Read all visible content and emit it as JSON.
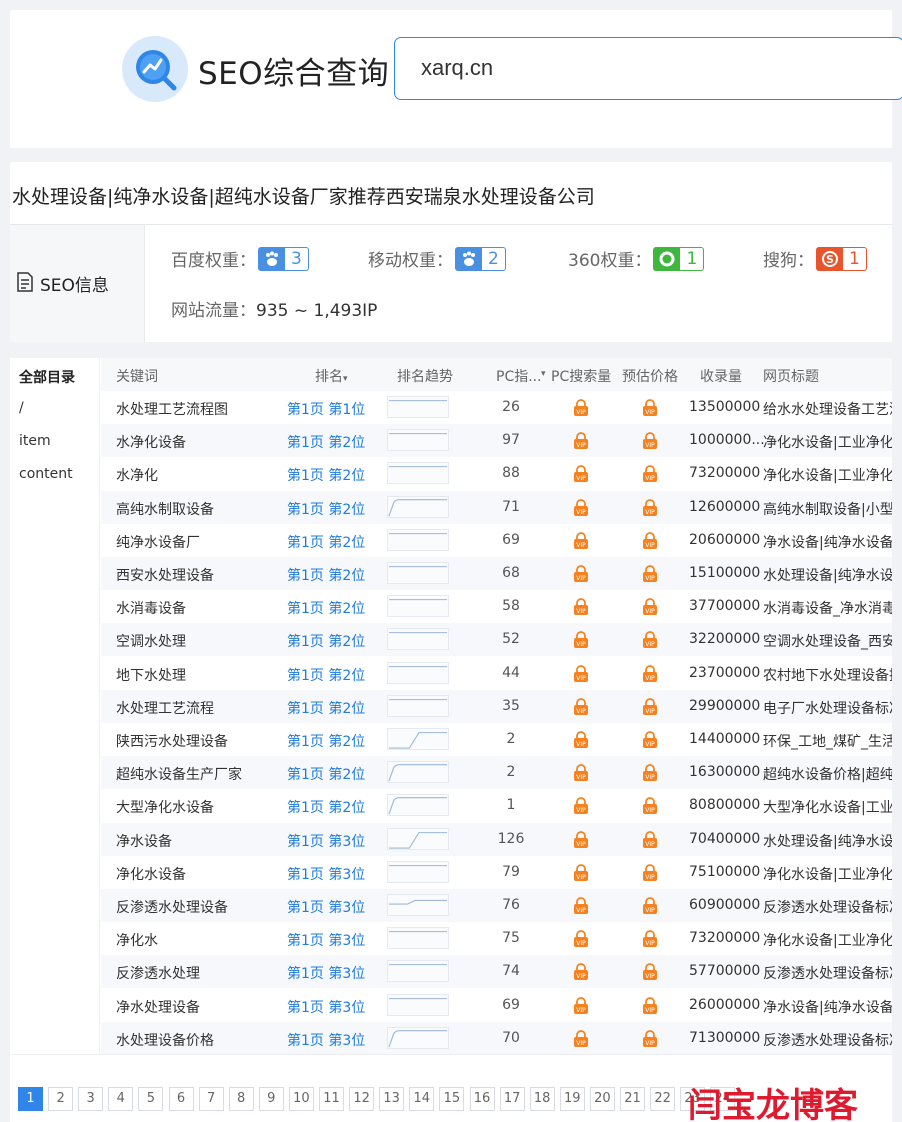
{
  "header": {
    "brand": "SEO综合查询",
    "search_value": "xarq.cn"
  },
  "site": {
    "title": "水处理设备|纯净水设备|超纯水设备厂家推荐西安瑞泉水处理设备公司",
    "section_label": "SEO信息",
    "weights": [
      {
        "label": "百度权重：",
        "value": "3",
        "icon": "baidu-paw-icon",
        "color": "#4a90e2"
      },
      {
        "label": "移动权重：",
        "value": "2",
        "icon": "baidu-paw-icon",
        "color": "#4a90e2"
      },
      {
        "label": "360权重：",
        "value": "1",
        "icon": "360-icon",
        "color": "#3fb73f"
      },
      {
        "label": "搜狗：",
        "value": "1",
        "icon": "sogou-icon",
        "color": "#e8542b"
      }
    ],
    "traffic_label": "网站流量：",
    "traffic_value": "935 ~ 1,493IP"
  },
  "sidebar": {
    "header": "全部目录",
    "items": [
      "/",
      "item",
      "content"
    ]
  },
  "table": {
    "columns": [
      "关键词",
      "排名",
      "排名趋势",
      "PC指...",
      "PC搜索量",
      "预估价格",
      "收录量",
      "网页标题"
    ],
    "rows": [
      {
        "keyword": "水处理工艺流程图",
        "rank": "第1页 第1位",
        "pc_index": "26",
        "indexed": "13500000",
        "title": "给水水处理设备工艺流程",
        "trend": "flat"
      },
      {
        "keyword": "水净化设备",
        "rank": "第1页 第2位",
        "pc_index": "97",
        "indexed": "1000000...",
        "title": "净化水设备|工业净化水设备",
        "trend": "flat"
      },
      {
        "keyword": "水净化",
        "rank": "第1页 第2位",
        "pc_index": "88",
        "indexed": "73200000",
        "title": "净化水设备|工业净化水设备",
        "trend": "flat"
      },
      {
        "keyword": "高纯水制取设备",
        "rank": "第1页 第2位",
        "pc_index": "71",
        "indexed": "12600000",
        "title": "高纯水制取设备|小型高纯水",
        "trend": "rise-early"
      },
      {
        "keyword": "纯净水设备厂",
        "rank": "第1页 第2位",
        "pc_index": "69",
        "indexed": "20600000",
        "title": "净水设备|纯净水设备厂家",
        "trend": "flat"
      },
      {
        "keyword": "西安水处理设备",
        "rank": "第1页 第2位",
        "pc_index": "68",
        "indexed": "15100000",
        "title": "水处理设备|纯净水设备",
        "trend": "flat"
      },
      {
        "keyword": "水消毒设备",
        "rank": "第1页 第2位",
        "pc_index": "58",
        "indexed": "37700000",
        "title": "水消毒设备_净水消毒设备",
        "trend": "flat"
      },
      {
        "keyword": "空调水处理",
        "rank": "第1页 第2位",
        "pc_index": "52",
        "indexed": "32200000",
        "title": "空调水处理设备_西安空调",
        "trend": "flat"
      },
      {
        "keyword": "地下水处理",
        "rank": "第1页 第2位",
        "pc_index": "44",
        "indexed": "23700000",
        "title": "农村地下水处理设备推荐",
        "trend": "flat"
      },
      {
        "keyword": "水处理工艺流程",
        "rank": "第1页 第2位",
        "pc_index": "35",
        "indexed": "29900000",
        "title": "电子厂水处理设备标准",
        "trend": "flat"
      },
      {
        "keyword": "陕西污水处理设备",
        "rank": "第1页 第2位",
        "pc_index": "2",
        "indexed": "14400000",
        "title": "环保_工地_煤矿_生活污水",
        "trend": "rise-mid"
      },
      {
        "keyword": "超纯水设备生产厂家",
        "rank": "第1页 第2位",
        "pc_index": "2",
        "indexed": "16300000",
        "title": "超纯水设备价格|超纯水",
        "trend": "rise-early"
      },
      {
        "keyword": "大型净化水设备",
        "rank": "第1页 第2位",
        "pc_index": "1",
        "indexed": "80800000",
        "title": "大型净化水设备|工业净化",
        "trend": "rise-early"
      },
      {
        "keyword": "净水设备",
        "rank": "第1页 第3位",
        "pc_index": "126",
        "indexed": "70400000",
        "title": "水处理设备|纯净水设备",
        "trend": "rise-mid"
      },
      {
        "keyword": "净化水设备",
        "rank": "第1页 第3位",
        "pc_index": "79",
        "indexed": "75100000",
        "title": "净化水设备|工业净化水设备",
        "trend": "flat"
      },
      {
        "keyword": "反渗透水处理设备",
        "rank": "第1页 第3位",
        "pc_index": "76",
        "indexed": "60900000",
        "title": "反渗透水处理设备标准",
        "trend": "small-bump"
      },
      {
        "keyword": "净化水",
        "rank": "第1页 第3位",
        "pc_index": "75",
        "indexed": "73200000",
        "title": "净化水设备|工业净化水设备",
        "trend": "flat"
      },
      {
        "keyword": "反渗透水处理",
        "rank": "第1页 第3位",
        "pc_index": "74",
        "indexed": "57700000",
        "title": "反渗透水处理设备标准",
        "trend": "flat"
      },
      {
        "keyword": "净水处理设备",
        "rank": "第1页 第3位",
        "pc_index": "69",
        "indexed": "26000000",
        "title": "净水设备|纯净水设备厂家",
        "trend": "flat"
      },
      {
        "keyword": "水处理设备价格",
        "rank": "第1页 第3位",
        "pc_index": "70",
        "indexed": "71300000",
        "title": "反渗透水处理设备标准",
        "trend": "rise-early"
      }
    ]
  },
  "pagination": {
    "current": "1",
    "pages": [
      "1",
      "2",
      "3",
      "4",
      "5",
      "6",
      "7",
      "8",
      "9",
      "10",
      "11",
      "12",
      "13",
      "14",
      "15",
      "16",
      "17",
      "18",
      "19",
      "20",
      "21",
      "22",
      "23",
      "24"
    ]
  },
  "watermark": "闫宝龙博客",
  "colors": {
    "accent": "#2f86e8",
    "rank_link": "#1e7be0",
    "lock": "#f5821f",
    "watermark": "#e01a2e"
  }
}
